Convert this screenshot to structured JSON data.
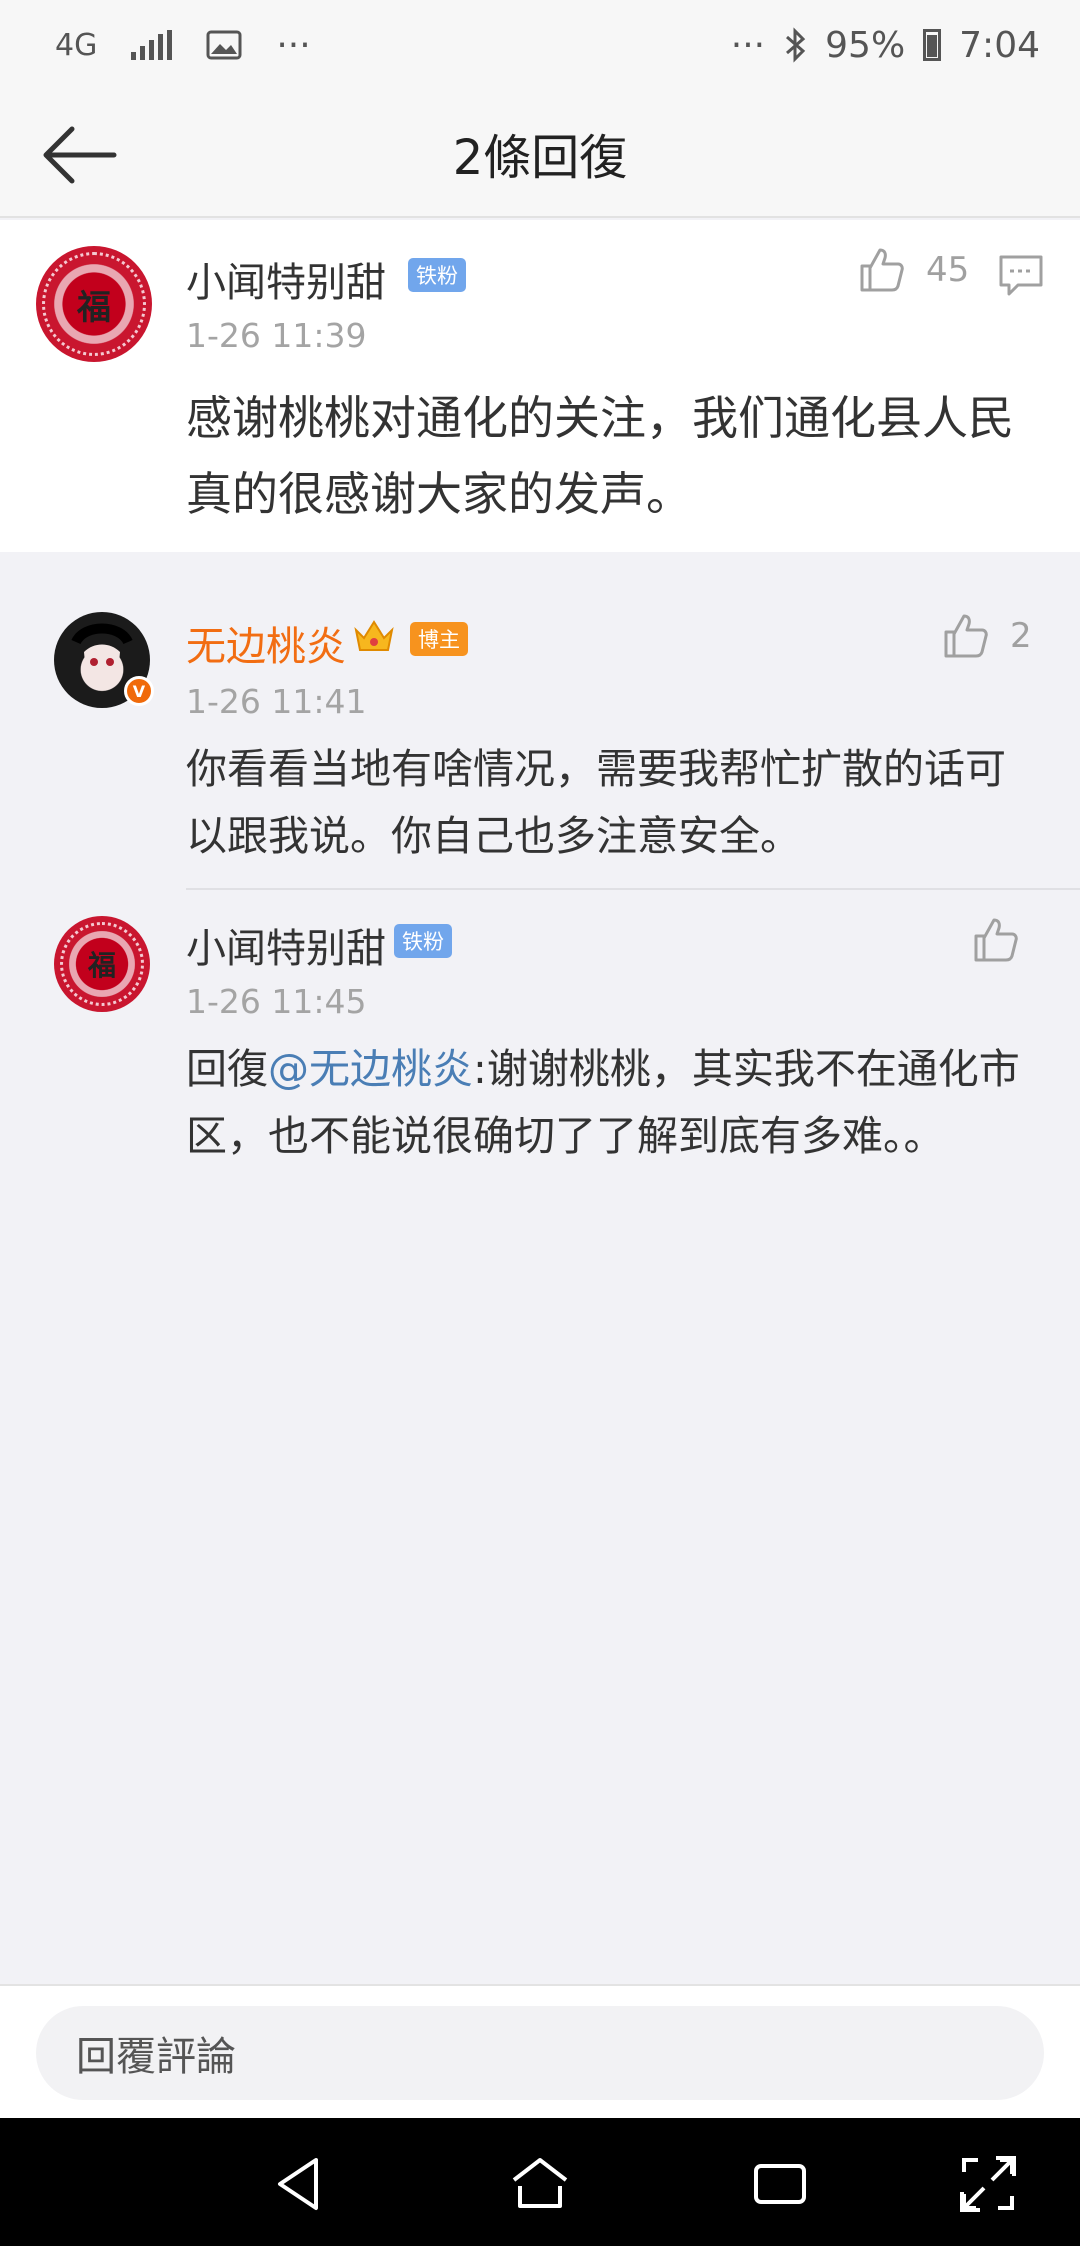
{
  "status_bar": {
    "network": "4G",
    "more_left": "···",
    "more_right": "···",
    "battery": "95%",
    "time": "7:04"
  },
  "nav": {
    "title": "2條回復"
  },
  "main_comment": {
    "username": "小闻特别甜",
    "badge": "铁粉",
    "avatar_text": "福",
    "time": "1-26 11:39",
    "likes": "45",
    "content": "感谢桃桃对通化的关注，我们通化县人民真的很感谢大家的发声。"
  },
  "replies": [
    {
      "username": "无边桃炎",
      "badge": "博主",
      "time": "1-26 11:41",
      "likes": "2",
      "content": "你看看当地有啥情况，需要我帮忙扩散的话可以跟我说。你自己也多注意安全。"
    },
    {
      "username": "小闻特别甜",
      "badge": "铁粉",
      "avatar_text": "福",
      "time": "1-26 11:45",
      "prefix": "回復",
      "mention": "@无边桃炎",
      "content": ":谢谢桃桃，其实我不在通化市区，也不能说很确切了了解到底有多难。。"
    }
  ],
  "bottom": {
    "reply_placeholder": "回覆評論"
  },
  "icons": {
    "back": "arrow-left-icon",
    "like": "thumbs-up-icon",
    "comment": "comment-icon",
    "crown": "crown-icon",
    "verified": "verified-badge-icon"
  },
  "colors": {
    "username_highlight": "#f26d12",
    "mention": "#4a7eb5",
    "fan_badge": "#71a6ec",
    "blogger_badge": "#f7931e"
  }
}
